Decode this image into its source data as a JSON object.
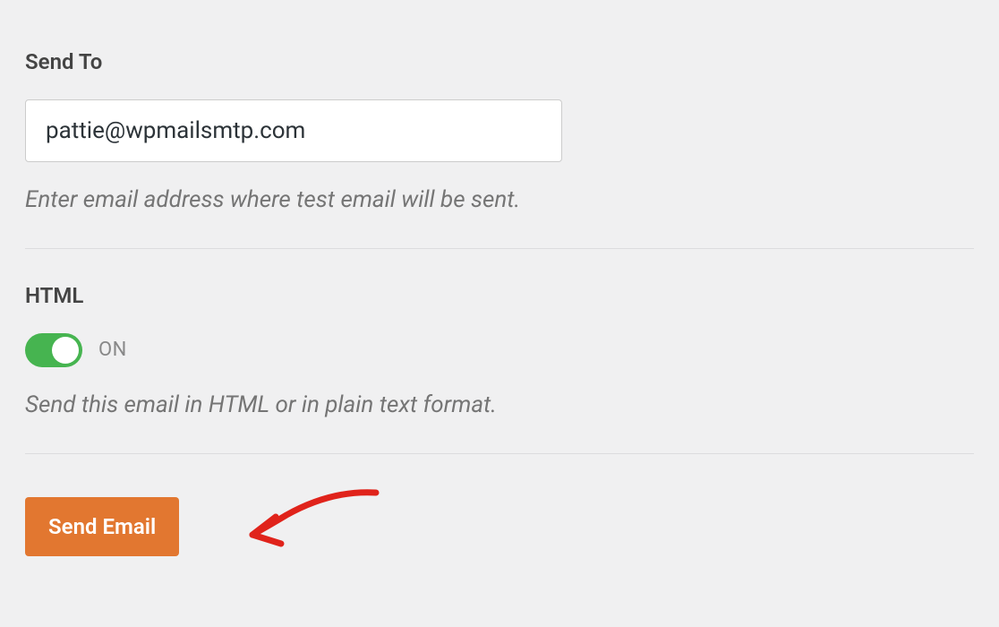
{
  "sendTo": {
    "label": "Send To",
    "value": "pattie@wpmailsmtp.com",
    "help": "Enter email address where test email will be sent."
  },
  "htmlFormat": {
    "label": "HTML",
    "state": "ON",
    "help": "Send this email in HTML or in plain text format."
  },
  "actions": {
    "sendEmail": "Send Email"
  },
  "colors": {
    "buttonBg": "#e27730",
    "toggleOn": "#46b450",
    "arrow": "#e0231b"
  }
}
